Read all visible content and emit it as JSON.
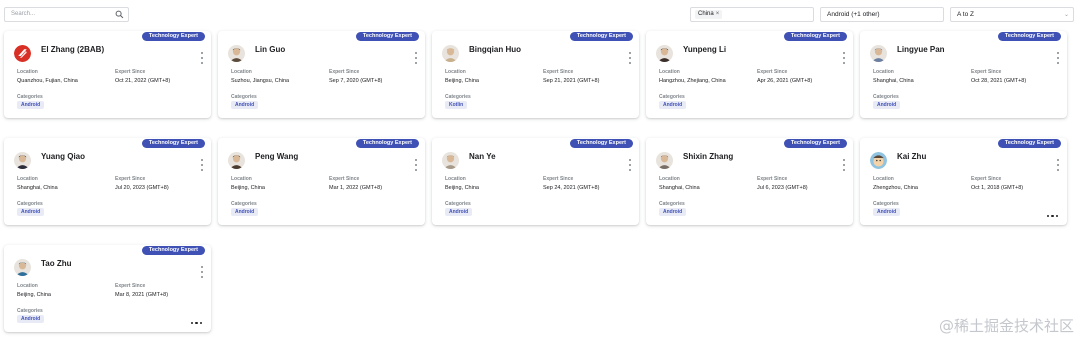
{
  "filters": {
    "search_placeholder": "Search...",
    "search_icon": "search-icon",
    "country_chip": "China",
    "chip_remove": "×",
    "category_value": "Android (+1 other)",
    "sort_value": "A to Z",
    "dropdown_icon": "chevron-down-icon"
  },
  "labels": {
    "badge": "Technology Expert",
    "location": "Location",
    "expert_since": "Expert Since",
    "categories": "Categories"
  },
  "experts": [
    {
      "name": "El Zhang (2BAB)",
      "location": "Quanzhou, Fujian, China",
      "since": "Oct 21, 2022 (GMT+8)",
      "category": "Android",
      "avatar_color": "#d93025",
      "avatar_kind": "logo",
      "more": false
    },
    {
      "name": "Lin Guo",
      "location": "Suzhou, Jiangsu, China",
      "since": "Sep 7, 2020 (GMT+8)",
      "category": "Android",
      "avatar_color": "#5d4b3c",
      "avatar_kind": "photo",
      "more": false
    },
    {
      "name": "Bingqian Huo",
      "location": "Beijing, China",
      "since": "Sep 21, 2021 (GMT+8)",
      "category": "Kotlin",
      "avatar_color": "#c9b08c",
      "avatar_kind": "photo",
      "more": false
    },
    {
      "name": "Yunpeng Li",
      "location": "Hangzhou, Zhejiang, China",
      "since": "Apr 26, 2021 (GMT+8)",
      "category": "Android",
      "avatar_color": "#3b2f2a",
      "avatar_kind": "photo",
      "more": false
    },
    {
      "name": "Lingyue Pan",
      "location": "Shanghai, China",
      "since": "Oct 28, 2021 (GMT+8)",
      "category": "Android",
      "avatar_color": "#6b7fa0",
      "avatar_kind": "photo",
      "more": false
    },
    {
      "name": "Yuang Qiao",
      "location": "Shanghai, China",
      "since": "Jul 20, 2023 (GMT+8)",
      "category": "Android",
      "avatar_color": "#2c2c3a",
      "avatar_kind": "photo",
      "more": false
    },
    {
      "name": "Peng Wang",
      "location": "Beijing, China",
      "since": "Mar 1, 2022 (GMT+8)",
      "category": "Android",
      "avatar_color": "#4a3b2e",
      "avatar_kind": "photo",
      "more": false
    },
    {
      "name": "Nan Ye",
      "location": "Beijing, China",
      "since": "Sep 24, 2021 (GMT+8)",
      "category": "Android",
      "avatar_color": "#a89a88",
      "avatar_kind": "photo",
      "more": false
    },
    {
      "name": "Shixin Zhang",
      "location": "Shanghai, China",
      "since": "Jul 6, 2023 (GMT+8)",
      "category": "Android",
      "avatar_color": "#7a6f66",
      "avatar_kind": "photo",
      "more": false
    },
    {
      "name": "Kai Zhu",
      "location": "Zhengzhou, China",
      "since": "Oct 1, 2018 (GMT+8)",
      "category": "Android",
      "avatar_color": "#8fc3e0",
      "avatar_kind": "cartoon",
      "more": true
    },
    {
      "name": "Tao Zhu",
      "location": "Beijing, China",
      "since": "Mar 8, 2021 (GMT+8)",
      "category": "Android",
      "avatar_color": "#2f6f9a",
      "avatar_kind": "photo",
      "more": true
    }
  ],
  "watermark": "@稀土掘金技术社区"
}
